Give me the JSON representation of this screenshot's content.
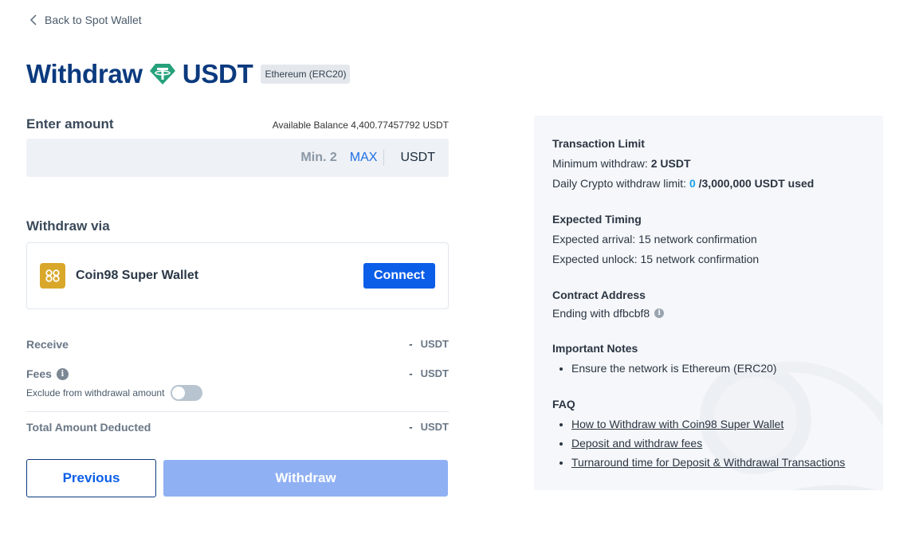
{
  "nav": {
    "back_label": "Back to Spot Wallet"
  },
  "header": {
    "title_prefix": "Withdraw",
    "coin": "USDT",
    "network": "Ethereum (ERC20)"
  },
  "amount": {
    "label": "Enter amount",
    "balance_label": "Available Balance",
    "balance_value": "4,400.77457792 USDT",
    "min_label": "Min. 2",
    "max_label": "MAX",
    "unit": "USDT"
  },
  "withdraw_via": {
    "label": "Withdraw via",
    "wallet_name": "Coin98 Super Wallet",
    "connect_label": "Connect"
  },
  "summary": {
    "receive_label": "Receive",
    "receive_value": "-",
    "receive_unit": "USDT",
    "fees_label": "Fees",
    "fees_value": "-",
    "fees_unit": "USDT",
    "exclude_label": "Exclude from withdrawal amount",
    "exclude_enabled": false,
    "total_label": "Total Amount Deducted",
    "total_value": "-",
    "total_unit": "USDT"
  },
  "actions": {
    "previous_label": "Previous",
    "withdraw_label": "Withdraw"
  },
  "info_panel": {
    "limit_title": "Transaction Limit",
    "min_withdraw_label": "Minimum withdraw:",
    "min_withdraw_value": "2 USDT",
    "daily_label": "Daily Crypto withdraw limit:",
    "daily_used": "0",
    "daily_total": "/3,000,000 USDT used",
    "timing_title": "Expected Timing",
    "arrival": "Expected arrival: 15 network confirmation",
    "unlock": "Expected unlock: 15 network confirmation",
    "contract_title": "Contract Address",
    "contract_value": "Ending with dfbcbf8",
    "notes_title": "Important Notes",
    "notes": [
      "Ensure the network is Ethereum (ERC20)"
    ],
    "faq_title": "FAQ",
    "faq_links": [
      "How to Withdraw with Coin98 Super Wallet",
      "Deposit and withdraw fees",
      "Turnaround time for Deposit & Withdrawal Transactions"
    ]
  },
  "colors": {
    "brand_navy": "#0b3a7e",
    "primary_blue": "#0b5ee8",
    "tether_green": "#26a17b",
    "disabled_blue": "#8fb0f3"
  }
}
